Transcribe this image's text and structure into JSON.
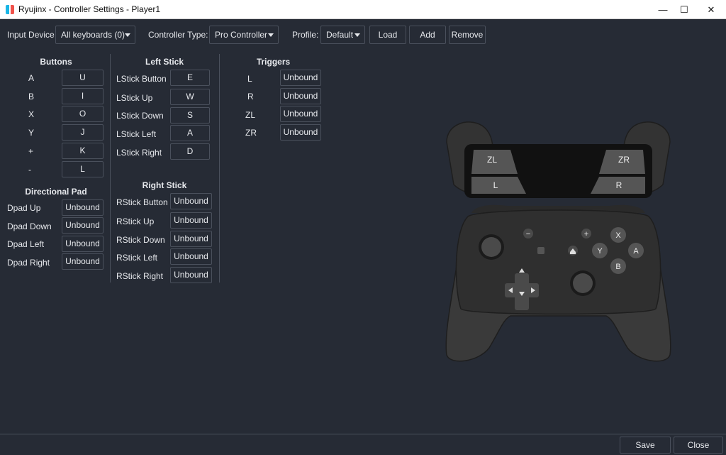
{
  "window": {
    "title": "Ryujinx - Controller Settings - Player1",
    "minimize": "—",
    "maximize": "☐",
    "close": "✕"
  },
  "toolbar": {
    "input_device_label": "Input Device",
    "input_device_value": "All keyboards (0)",
    "controller_type_label": "Controller Type:",
    "controller_type_value": "Pro Controller",
    "profile_label": "Profile:",
    "profile_value": "Default",
    "load": "Load",
    "add": "Add",
    "remove": "Remove"
  },
  "buttons": {
    "title": "Buttons",
    "rows": [
      {
        "label": "A",
        "key": "U"
      },
      {
        "label": "B",
        "key": "I"
      },
      {
        "label": "X",
        "key": "O"
      },
      {
        "label": "Y",
        "key": "J"
      },
      {
        "label": "+",
        "key": "K"
      },
      {
        "label": "-",
        "key": "L"
      }
    ]
  },
  "dpad": {
    "title": "Directional Pad",
    "rows": [
      {
        "label": "Dpad Up",
        "key": "Unbound"
      },
      {
        "label": "Dpad Down",
        "key": "Unbound"
      },
      {
        "label": "Dpad Left",
        "key": "Unbound"
      },
      {
        "label": "Dpad Right",
        "key": "Unbound"
      }
    ]
  },
  "left_stick": {
    "title": "Left Stick",
    "rows": [
      {
        "label": "LStick Button",
        "key": "E"
      },
      {
        "label": "LStick Up",
        "key": "W"
      },
      {
        "label": "LStick Down",
        "key": "S"
      },
      {
        "label": "LStick Left",
        "key": "A"
      },
      {
        "label": "LStick Right",
        "key": "D"
      }
    ]
  },
  "right_stick": {
    "title": "Right Stick",
    "rows": [
      {
        "label": "RStick Button",
        "key": "Unbound"
      },
      {
        "label": "RStick Up",
        "key": "Unbound"
      },
      {
        "label": "RStick Down",
        "key": "Unbound"
      },
      {
        "label": "RStick Left",
        "key": "Unbound"
      },
      {
        "label": "RStick Right",
        "key": "Unbound"
      }
    ]
  },
  "triggers": {
    "title": "Triggers",
    "rows": [
      {
        "label": "L",
        "key": "Unbound"
      },
      {
        "label": "R",
        "key": "Unbound"
      },
      {
        "label": "ZL",
        "key": "Unbound"
      },
      {
        "label": "ZR",
        "key": "Unbound"
      }
    ]
  },
  "controller_image": {
    "zl": "ZL",
    "zr": "ZR",
    "l": "L",
    "r": "R",
    "btn_x": "X",
    "btn_y": "Y",
    "btn_a": "A",
    "btn_b": "B",
    "minus": "−",
    "plus": "+"
  },
  "footer": {
    "save": "Save",
    "close": "Close"
  },
  "colors": {
    "background": "#262b35",
    "border": "#4a505c",
    "text": "#e6e8ec",
    "controller_body": "#2f2f2f",
    "controller_grip": "#3a3a3a"
  }
}
